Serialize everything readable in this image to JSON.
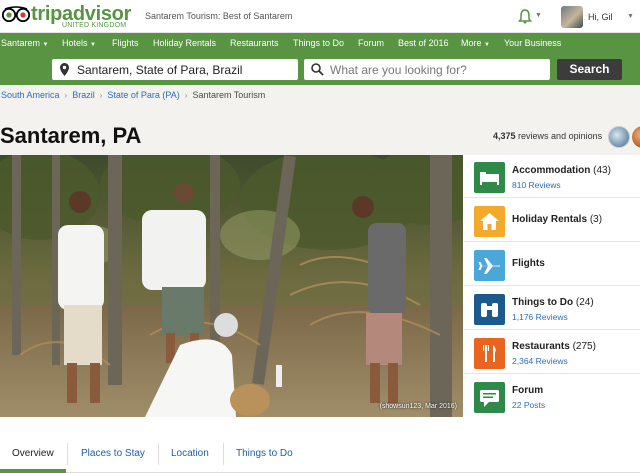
{
  "brand": {
    "name": "tripadvisor",
    "sub": "UNITED KINGDOM",
    "color": "#589442"
  },
  "header": {
    "page_heading": "Santarem Tourism: Best of Santarem",
    "greeting": "Hi, Gil"
  },
  "nav": {
    "items": [
      {
        "label": "Santarem",
        "dropdown": true
      },
      {
        "label": "Hotels",
        "dropdown": true
      },
      {
        "label": "Flights",
        "dropdown": false
      },
      {
        "label": "Holiday Rentals",
        "dropdown": false
      },
      {
        "label": "Restaurants",
        "dropdown": false
      },
      {
        "label": "Things to Do",
        "dropdown": false
      },
      {
        "label": "Forum",
        "dropdown": false
      },
      {
        "label": "Best of 2016",
        "dropdown": false
      },
      {
        "label": "More",
        "dropdown": true
      },
      {
        "label": "Your Business",
        "dropdown": false
      }
    ]
  },
  "search": {
    "location_value": "Santarem, State of Para, Brazil",
    "query_placeholder": "What are you looking for?",
    "button_label": "Search"
  },
  "breadcrumb": {
    "items": [
      "South America",
      "Brazil",
      "State of Para (PA)",
      "Santarem Tourism"
    ]
  },
  "location": {
    "title": "Santarem, PA",
    "reviews_count": "4,375",
    "reviews_label": "reviews and opinions"
  },
  "photo": {
    "credit": "(showsun123, Mar 2016)"
  },
  "sidebar": {
    "items": [
      {
        "label": "Accommodation",
        "count": "(43)",
        "sub": "810 Reviews",
        "icon": "bed-icon",
        "color": "#2f8a4a"
      },
      {
        "label": "Holiday Rentals",
        "count": "(3)",
        "sub": "",
        "icon": "house-icon",
        "color": "#f2a92c"
      },
      {
        "label": "Flights",
        "count": "",
        "sub": "",
        "icon": "plane-icon",
        "color": "#4aa8d8"
      },
      {
        "label": "Things to Do",
        "count": "(24)",
        "sub": "1,176 Reviews",
        "icon": "binoculars-icon",
        "color": "#1c5a8c"
      },
      {
        "label": "Restaurants",
        "count": "(275)",
        "sub": "2,364 Reviews",
        "icon": "cutlery-icon",
        "color": "#e8651f"
      },
      {
        "label": "Forum",
        "count": "",
        "sub": "22 Posts",
        "icon": "speech-bubble-icon",
        "color": "#2f8a4a"
      }
    ]
  },
  "tabs": {
    "items": [
      "Overview",
      "Places to Stay",
      "Location",
      "Things to Do"
    ],
    "active": "Overview"
  }
}
